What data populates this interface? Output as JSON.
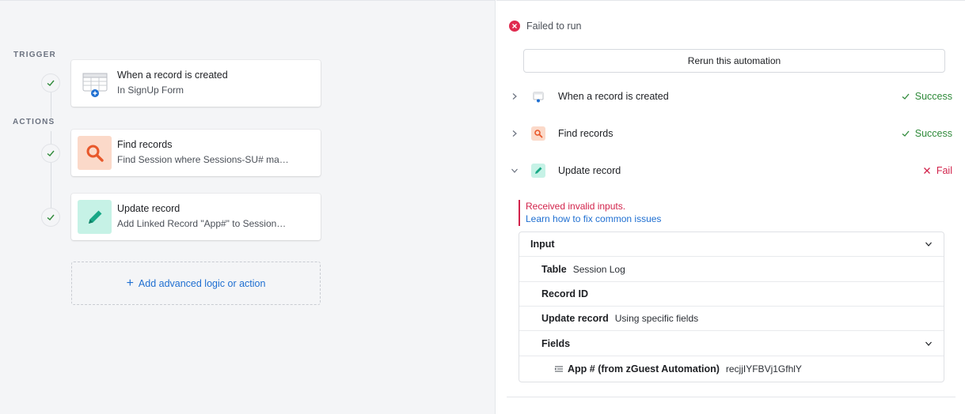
{
  "left": {
    "trigger_label": "TRIGGER",
    "actions_label": "ACTIONS",
    "cards": [
      {
        "title": "When a record is created",
        "subtitle": "In SignUp Form",
        "icon": "table-plus-icon"
      },
      {
        "title": "Find records",
        "subtitle": "Find Session where Sessions-SU# ma…",
        "icon": "search-icon",
        "color": "#fbd9c9",
        "accent": "#e8582b"
      },
      {
        "title": "Update record",
        "subtitle": "Add Linked Record \"App#\" to Session…",
        "icon": "pencil-icon",
        "color": "#c6f2e6",
        "accent": "#18a886"
      }
    ],
    "add_action_label": "Add advanced logic or action"
  },
  "right": {
    "status": "Failed to run",
    "rerun_label": "Rerun this automation",
    "steps": [
      {
        "label": "When a record is created",
        "status": "Success",
        "expanded": false
      },
      {
        "label": "Find records",
        "status": "Success",
        "expanded": false
      },
      {
        "label": "Update record",
        "status": "Fail",
        "expanded": true
      }
    ],
    "error_message": "Received invalid inputs.",
    "error_link": "Learn how to fix common issues",
    "input": {
      "header": "Input",
      "rows": [
        {
          "key": "Table",
          "value": "Session Log"
        },
        {
          "key": "Record ID",
          "value": ""
        },
        {
          "key": "Update record",
          "value": "Using specific fields"
        },
        {
          "key": "Fields",
          "value": ""
        }
      ],
      "field": {
        "key": "App # (from zGuest Automation)",
        "value": "recjjIYFBVj1GfhlY"
      }
    }
  },
  "colors": {
    "success": "#2f8a3a",
    "fail": "#d2234b",
    "link": "#1f6fd1"
  }
}
